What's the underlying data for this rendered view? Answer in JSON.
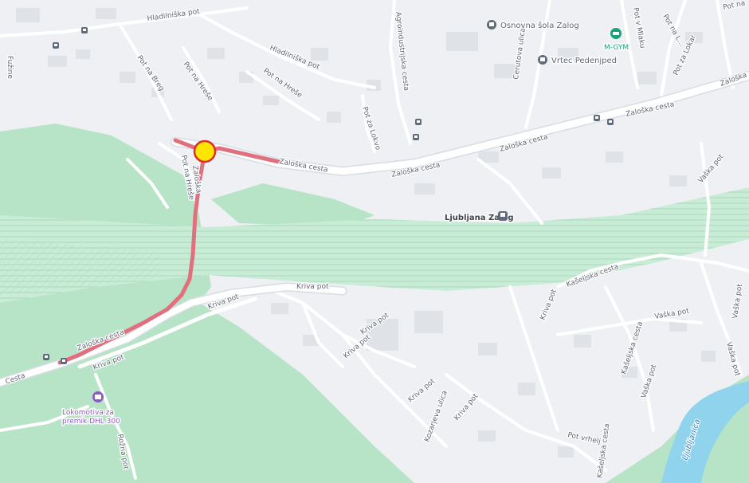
{
  "colors": {
    "land": "#eef0f3",
    "park": "#b7e4c7",
    "rail_zone": "#c9ecd6",
    "water": "#8fd3ec",
    "road": "#ffffff",
    "main_road": "#d7dde4",
    "route": "#e0707e",
    "marker": "#ffe600",
    "poi_school": "#5f6b7a",
    "poi_gym": "#1aa37a",
    "poi_museum": "#8b5cc4"
  },
  "route_label": "Zaloška",
  "streets": {
    "hladnikova_1": "Hladilniška pot",
    "hladnikova_2": "Hladilniška pot",
    "pot_na_breg": "Pot na Breg",
    "pot_na_hrib": "Pot na Hreše",
    "pot_na_hribu_2": "Pot na Hreše",
    "pot_na_hribu_3": "Pot na Hreše",
    "pot_za_lokvo": "Pot za Lokvo",
    "zaloska_1": "Zaloška cesta",
    "zaloska_2": "Zaloška cesta",
    "zaloska_3": "Zaloška cesta",
    "zaloska_4": "Zaloška cesta",
    "zaloska_5": "Zaloška",
    "zaloska_sw": "Zaloška cesta",
    "cerutova": "Cerutova ulica",
    "agroind": "Agroindustrijska cesta",
    "kriva_1": "Kriva pot",
    "kriva_2": "Kriva pot",
    "kriva_3": "Kriva pot",
    "kriva_4": "Kriva pot",
    "kriva_5": "Kriva pot",
    "kriva_6": "Kriva pot",
    "kriva_7": "Kriva pot",
    "kriva_8": "Kriva pot",
    "kaselska_1": "Kašeljska cesta",
    "kaselska_2": "Kašeljska cesta",
    "kaselska_3": "Kašeljska cesta",
    "vaska_1": "Vaška pot",
    "vaska_2": "Vaška pot",
    "vaska_3": "Vaška pot",
    "vaska_4": "Vaška pot",
    "vaska_5": "Vaška pot",
    "pot_v_mlaku": "Pot v Mlaku",
    "pot_za_lokar": "Pot za Lokar",
    "pot_na_l": "Pot na L...",
    "pot_vr": "Pot vrhelj",
    "rozna": "Rožna pot",
    "kozarje": "Kozarjeva ulica",
    "pot_edge": "Pot na",
    "cesta_edge": "Cesta",
    "fuzine": "Fužine",
    "zaloska_tr": "Zaloška"
  },
  "pois": {
    "school": "Osnovna šola Zalog",
    "kindergarten": "Vrtec Pedenjped",
    "gym": "M-GYM",
    "station": "Ljubljana Zalog",
    "museum_1": "Lokomotiva za",
    "museum_2": "premik DHL 300"
  },
  "river": "Ljubljanica",
  "icons": {
    "school": "school-icon",
    "gym": "gym-icon",
    "station": "train-station-icon",
    "bus": "bus-stop-icon",
    "museum": "museum-icon",
    "marker": "location-marker"
  }
}
